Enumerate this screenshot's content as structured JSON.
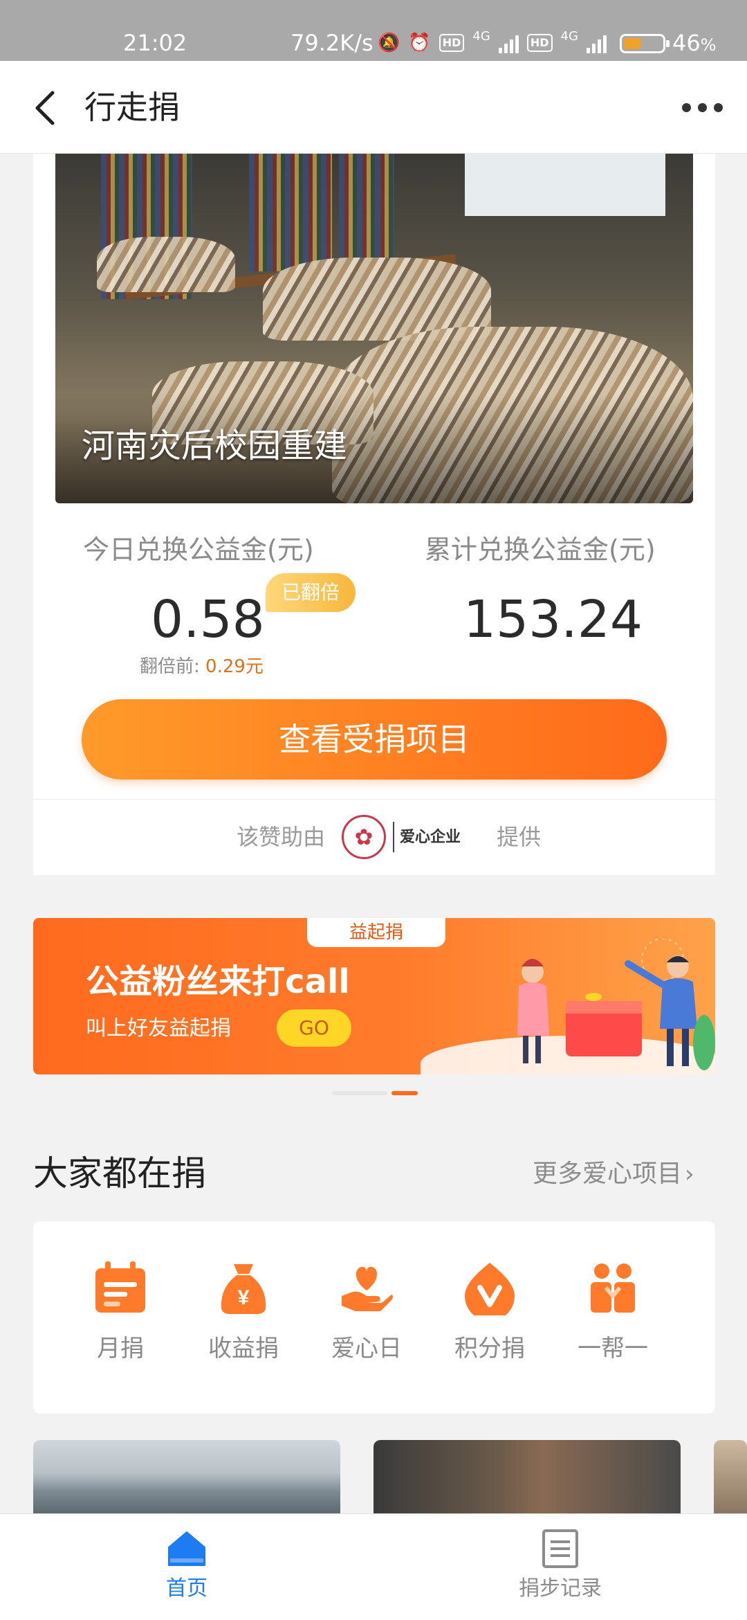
{
  "status_bar": {
    "time": "21:02",
    "network_speed": "79.2K/s",
    "battery_percent": "46",
    "battery_unit": "%",
    "hd_label": "HD",
    "signal_label": "4G",
    "battery_level": 0.46
  },
  "navbar": {
    "title": "行走捐",
    "back_icon": "chevron-left-icon",
    "more_icon": "more-dots-icon"
  },
  "project": {
    "caption": "河南灾后校园重建"
  },
  "stats": {
    "today_label": "今日兑换公益金(元)",
    "today_value": "0.58",
    "doubled_badge": "已翻倍",
    "before_label": "翻倍前: ",
    "before_value": "0.29",
    "before_unit": "元",
    "total_label": "累计兑换公益金(元)",
    "total_value": "153.24"
  },
  "cta": {
    "label": "查看受捐项目"
  },
  "sponsor": {
    "prefix": "该赞助由",
    "company": "爱心企业",
    "suffix": "提供"
  },
  "banner": {
    "tag": "益起捐",
    "headline": "公益粉丝来打call",
    "subline": "叫上好友益起捐",
    "go_label": "GO"
  },
  "section": {
    "title": "大家都在捐",
    "more_label": "更多爱心项目",
    "more_chevron": "›"
  },
  "categories": [
    {
      "label": "月捐",
      "icon": "calendar-icon"
    },
    {
      "label": "收益捐",
      "icon": "money-bag-icon"
    },
    {
      "label": "爱心日",
      "icon": "heart-hand-icon"
    },
    {
      "label": "积分捐",
      "icon": "points-icon"
    },
    {
      "label": "一帮一",
      "icon": "one-help-one-icon"
    }
  ],
  "tabbar": {
    "home_label": "首页",
    "records_label": "捐步记录",
    "active_color": "#1e7cf2",
    "inactive_color": "#8c8c8c"
  },
  "colors": {
    "accent_orange": "#ff6a1e",
    "badge_yellow": "#f8b73c"
  }
}
